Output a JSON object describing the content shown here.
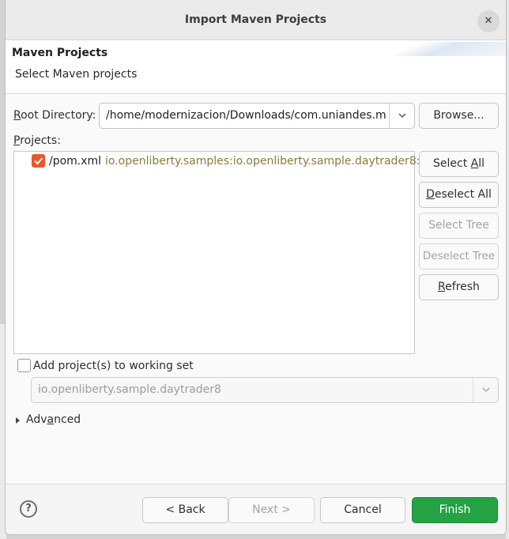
{
  "dialog": {
    "title": "Import Maven Projects",
    "close_glyph": "✕"
  },
  "banner": {
    "title": "Maven Projects",
    "subtitle": "Select Maven projects"
  },
  "root_directory": {
    "label_prefix": "R",
    "label_rest": "oot Directory:",
    "value": "/home/modernizacion/Downloads/com.uniandes.mis",
    "browse_label": "Browse..."
  },
  "projects": {
    "label_prefix": "P",
    "label_rest": "rojects:",
    "items": [
      {
        "name": "/pom.xml",
        "artifact": "io.openliberty.samples:io.openliberty.sample.daytrader8:",
        "checked": true
      }
    ]
  },
  "side_buttons": {
    "select_all_pre": "Select ",
    "select_all_u": "A",
    "select_all_post": "ll",
    "deselect_all_u": "D",
    "deselect_all_post": "eselect All",
    "select_tree": "Select Tree",
    "deselect_tree": "Deselect Tree",
    "refresh_u": "R",
    "refresh_post": "efresh"
  },
  "working_set": {
    "checkbox_label": "Add project(s) to working set",
    "checked": false,
    "value": "io.openliberty.sample.daytrader8"
  },
  "advanced": {
    "label_pre": "Adv",
    "label_u": "a",
    "label_post": "nced"
  },
  "footer": {
    "help_glyph": "?",
    "back_label": "< Back",
    "next_label": "Next >",
    "cancel_label": "Cancel",
    "finish_label": "Finish"
  },
  "colors": {
    "accent": "#e8572a",
    "finish_green": "#25a244",
    "artifact_text": "#8a7a3e"
  }
}
